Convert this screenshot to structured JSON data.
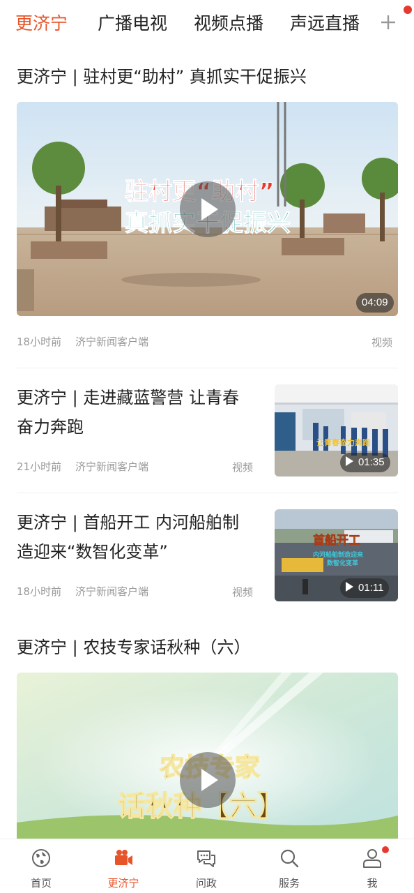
{
  "top_tabs": [
    {
      "label": "更济宁",
      "active": true
    },
    {
      "label": "广播电视",
      "active": false
    },
    {
      "label": "视频点播",
      "active": false
    },
    {
      "label": "声远直播",
      "active": false
    }
  ],
  "top_plus_icon": "plus-icon",
  "accent_color": "#e8542a",
  "feed": [
    {
      "title": "更济宁 | 驻村更“助村” 真抓实干促振兴",
      "overlay_line1": "驻村更“助村”",
      "overlay_line2": "真抓实干促振兴",
      "duration": "04:09",
      "time": "18小时前",
      "source": "济宁新闻客户端",
      "tag": "视频"
    },
    {
      "title": "更济宁 | 走进藏蓝警营 让青春奋力奔跑",
      "overlay_text": "让青春奋力奔跑",
      "duration": "01:35",
      "time": "21小时前",
      "source": "济宁新闻客户端",
      "tag": "视频"
    },
    {
      "title": "更济宁 | 首船开工 内河船舶制造迎来“数智化变革”",
      "overlay_line1": "首船开工",
      "overlay_line2": "内河船舶制造迎来",
      "overlay_line3": "数智化变革",
      "duration": "01:11",
      "time": "18小时前",
      "source": "济宁新闻客户端",
      "tag": "视频"
    },
    {
      "title": "更济宁 | 农技专家话秋种（六）",
      "overlay_line1": "农技专家",
      "overlay_line2": "话秋种【六】"
    }
  ],
  "bottom_nav": [
    {
      "label": "首页",
      "icon": "globe-icon",
      "active": false
    },
    {
      "label": "更济宁",
      "icon": "video-camera-icon",
      "active": true
    },
    {
      "label": "问政",
      "icon": "chat-bubbles-icon",
      "active": false
    },
    {
      "label": "服务",
      "icon": "search-icon",
      "active": false
    },
    {
      "label": "我",
      "icon": "user-icon",
      "active": false,
      "badge_dot": true
    }
  ]
}
